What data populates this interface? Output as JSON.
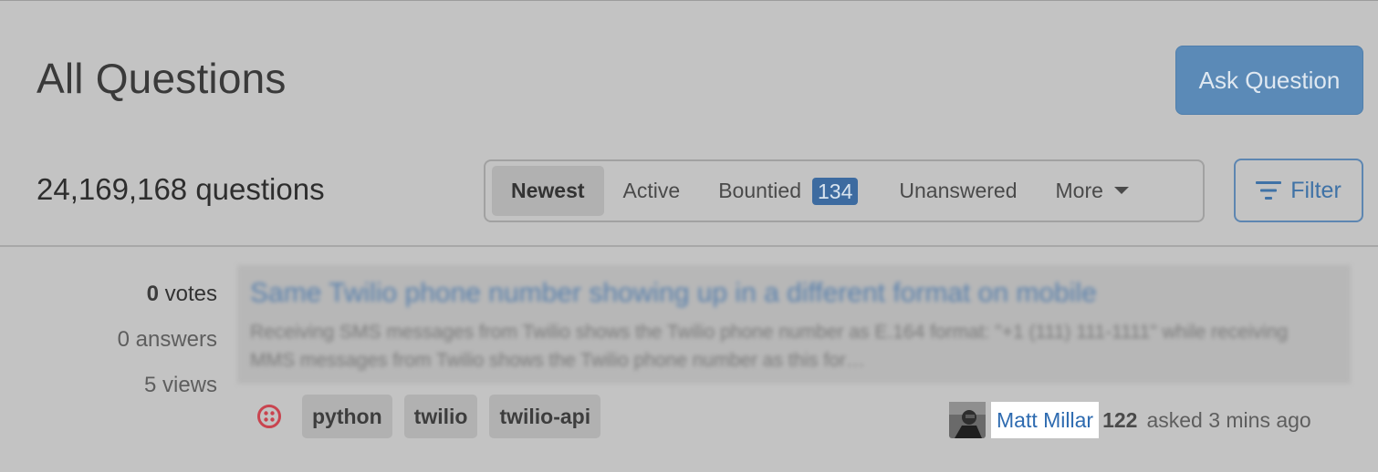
{
  "header": {
    "title": "All Questions",
    "ask_button": "Ask Question"
  },
  "toolbar": {
    "question_count": "24,169,168 questions",
    "tabs": [
      {
        "label": "Newest",
        "active": true
      },
      {
        "label": "Active",
        "active": false
      },
      {
        "label": "Bountied",
        "badge": "134",
        "active": false
      },
      {
        "label": "Unanswered",
        "active": false
      },
      {
        "label": "More",
        "active": false
      }
    ],
    "filter_label": "Filter"
  },
  "question": {
    "stats": {
      "votes_num": "0",
      "votes_label": "votes",
      "answers": "0 answers",
      "views": "5 views"
    },
    "title": "Same Twilio phone number showing up in a different format on mobile",
    "excerpt": "Receiving SMS messages from Twilio shows the Twilio phone number as E.164 format: \"+1 (111) 111-1111\" while receiving MMS messages from Twilio shows the Twilio phone number as this for…",
    "tags": [
      "python",
      "twilio",
      "twilio-api"
    ],
    "user": {
      "name": "Matt Millar",
      "reputation": "122",
      "asked": "asked 3 mins ago"
    }
  },
  "colors": {
    "accent": "#5b8ab7",
    "badge": "#3d6ba0",
    "link": "#2e6bb0",
    "watch_icon": "#c9444f"
  },
  "icons": {
    "filter": "filter-lines-icon",
    "watch": "watched-tag-icon",
    "avatar": "user-avatar"
  }
}
